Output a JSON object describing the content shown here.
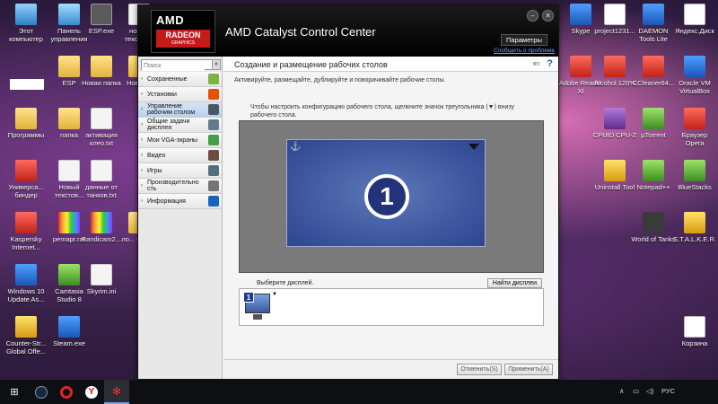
{
  "desktop": {
    "left_icons": [
      {
        "label": "Этот компьютер",
        "glyph": "g-pc"
      },
      {
        "label": "Панель управления",
        "glyph": "g-cp"
      },
      {
        "label": "ESP.exe",
        "glyph": "g-exe"
      },
      {
        "label": "новый текстов...",
        "glyph": "g-doc"
      },
      {
        "label": "ESP",
        "glyph": "g-folder"
      },
      {
        "label": "Новая папка",
        "glyph": "g-folder"
      },
      {
        "label": "Новая...",
        "glyph": "g-folder"
      },
      {
        "label": "Программы",
        "glyph": "g-folder"
      },
      {
        "label": "папка",
        "glyph": "g-folder"
      },
      {
        "label": "активация клео.txt",
        "glyph": "g-doc"
      },
      {
        "label": "Универса... биндер",
        "glyph": "g-red"
      },
      {
        "label": "Новый текстов...",
        "glyph": "g-doc"
      },
      {
        "label": "данные от танков.txt",
        "glyph": "g-doc"
      },
      {
        "label": "Kaspersky Internet...",
        "glyph": "g-red"
      },
      {
        "label": "pemapr.rar",
        "glyph": "g-rainbow"
      },
      {
        "label": "Bandicam2...",
        "glyph": "g-rainbow"
      },
      {
        "label": "ло... парс...",
        "glyph": "g-folder"
      },
      {
        "label": "Windows 10 Update As...",
        "glyph": "g-blue"
      },
      {
        "label": "Camtasia Studio 8",
        "glyph": "g-green"
      },
      {
        "label": "Skyrim.ini",
        "glyph": "g-doc"
      },
      {
        "label": "Counter-Str... Global Offe...",
        "glyph": "g-yellow"
      },
      {
        "label": "Steam.exe",
        "glyph": "g-blue"
      }
    ],
    "right_icons": [
      {
        "label": "Skype",
        "glyph": "g-blue"
      },
      {
        "label": "project1231...",
        "glyph": "g-white"
      },
      {
        "label": "DAEMON Tools Lite",
        "glyph": "g-blue"
      },
      {
        "label": "Яндекс.Диск",
        "glyph": "g-white"
      },
      {
        "label": "Adobe Reader XI",
        "glyph": "g-red"
      },
      {
        "label": "Alcohol 120%",
        "glyph": "g-red"
      },
      {
        "label": "CCleaner64...",
        "glyph": "g-red"
      },
      {
        "label": "Oracle VM VirtualBox",
        "glyph": "g-blue"
      },
      {
        "label": "CPUID CPU-Z",
        "glyph": "g-purple"
      },
      {
        "label": "µTorrent",
        "glyph": "g-green"
      },
      {
        "label": "Браузер Opera",
        "glyph": "g-red"
      },
      {
        "label": "Uninstall Tool",
        "glyph": "g-yellow"
      },
      {
        "label": "Notepad++",
        "glyph": "g-green"
      },
      {
        "label": "BlueStacks",
        "glyph": "g-green"
      },
      {
        "label": "World of Tanks",
        "glyph": "g-dark"
      },
      {
        "label": "S.T.A.L.K.E.R.",
        "glyph": "g-yellow"
      },
      {
        "label": "Корзина",
        "glyph": "g-white"
      }
    ]
  },
  "window": {
    "logo_amd": "AMD",
    "logo_radeon": "RADEON",
    "logo_graphics": "GRAPHICS",
    "title": "AMD Catalyst Control Center",
    "min_glyph": "–",
    "close_glyph": "✕",
    "preferences_label": "Параметры",
    "report_label": "Сообщить о проблеме",
    "search_placeholder": "Поиск",
    "collapse_glyph": "«"
  },
  "sidebar": {
    "items": [
      {
        "label": "Сохраненные",
        "icon_color": "#7cb342"
      },
      {
        "label": "Установки",
        "icon_color": "#e65100"
      },
      {
        "label": "Управление рабочим столом",
        "icon_color": "#455a64"
      },
      {
        "label": "Общие задачи дисплея",
        "icon_color": "#607d8b"
      },
      {
        "label": "Мои VGA-экраны",
        "icon_color": "#43a047"
      },
      {
        "label": "Видео",
        "icon_color": "#6d4c41"
      },
      {
        "label": "Игры",
        "icon_color": "#546e7a"
      },
      {
        "label": "Производительно сть",
        "icon_color": "#757575"
      },
      {
        "label": "Информация",
        "icon_color": "#1565c0"
      }
    ]
  },
  "main": {
    "heading": "Создание и размещение рабочих столов",
    "back_glyph": "⇚",
    "help_glyph": "?",
    "description": "Активируйте, размещайте, дублируйте и поворачивайте рабочие столы.",
    "instruction": "Чтобы настроить конфигурацию рабочего стола, щелкните значок треугольника (▼) внизу рабочего стола.",
    "display_number": "1",
    "select_display_label": "Выберите дисплей.",
    "find_displays_label": "Найти дисплеи",
    "cancel_label": "Отменить(S)",
    "apply_label": "Применить(A)"
  },
  "taskbar": {
    "start_glyph": "⊞",
    "language": "РУС"
  }
}
